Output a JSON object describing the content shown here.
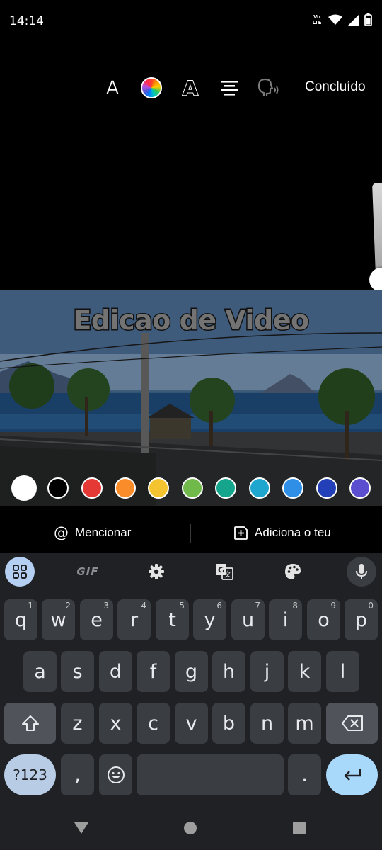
{
  "status_bar": {
    "time": "14:14",
    "volte_top": "Vo",
    "volte_bottom": "LTE",
    "icons": [
      "volte-icon",
      "wifi-icon",
      "cellular-signal-icon",
      "battery-icon"
    ]
  },
  "toolbar": {
    "font_icon": "A",
    "color_icon": "color-wheel-icon",
    "style_icon": "A",
    "align_icon": "align-center-icon",
    "voice_icon": "text-to-speech-icon",
    "done_label": "Concluído"
  },
  "overlay": {
    "text": "Edicao de Video"
  },
  "colors": {
    "swatches": [
      "#ffffff",
      "#000000",
      "#e53935",
      "#fb8c2a",
      "#f4c430",
      "#71b94a",
      "#14a58c",
      "#1ea6cf",
      "#2f8ee6",
      "#2440b8",
      "#5b4fcf"
    ],
    "selected": "#ffffff"
  },
  "actions": {
    "mention_label": "Mencionar",
    "mention_icon": "@",
    "add_label": "Adiciona o teu",
    "add_icon": "add-sticker-icon"
  },
  "keyboard": {
    "toolbar": {
      "apps_icon": "apps-grid-icon",
      "gif_label": "GIF",
      "settings_icon": "gear-icon",
      "translate_icon": "translate-icon",
      "theme_icon": "palette-icon",
      "mic_icon": "microphone-icon"
    },
    "row1": [
      {
        "key": "q",
        "hint": "1"
      },
      {
        "key": "w",
        "hint": "2"
      },
      {
        "key": "e",
        "hint": "3"
      },
      {
        "key": "r",
        "hint": "4"
      },
      {
        "key": "t",
        "hint": "5"
      },
      {
        "key": "y",
        "hint": "6"
      },
      {
        "key": "u",
        "hint": "7"
      },
      {
        "key": "i",
        "hint": "8"
      },
      {
        "key": "o",
        "hint": "9"
      },
      {
        "key": "p",
        "hint": "0"
      }
    ],
    "row2": [
      "a",
      "s",
      "d",
      "f",
      "g",
      "h",
      "j",
      "k",
      "l"
    ],
    "row3": [
      "z",
      "x",
      "c",
      "v",
      "b",
      "n",
      "m"
    ],
    "symbols_label": "?123",
    "comma": ",",
    "period": ".",
    "shift_icon": "shift-icon",
    "backspace_icon": "backspace-icon",
    "emoji_icon": "emoji-icon",
    "enter_icon": "enter-icon"
  },
  "nav_bar": {
    "back_icon": "back-triangle-icon",
    "home_icon": "home-circle-icon",
    "recents_icon": "recents-square-icon"
  }
}
